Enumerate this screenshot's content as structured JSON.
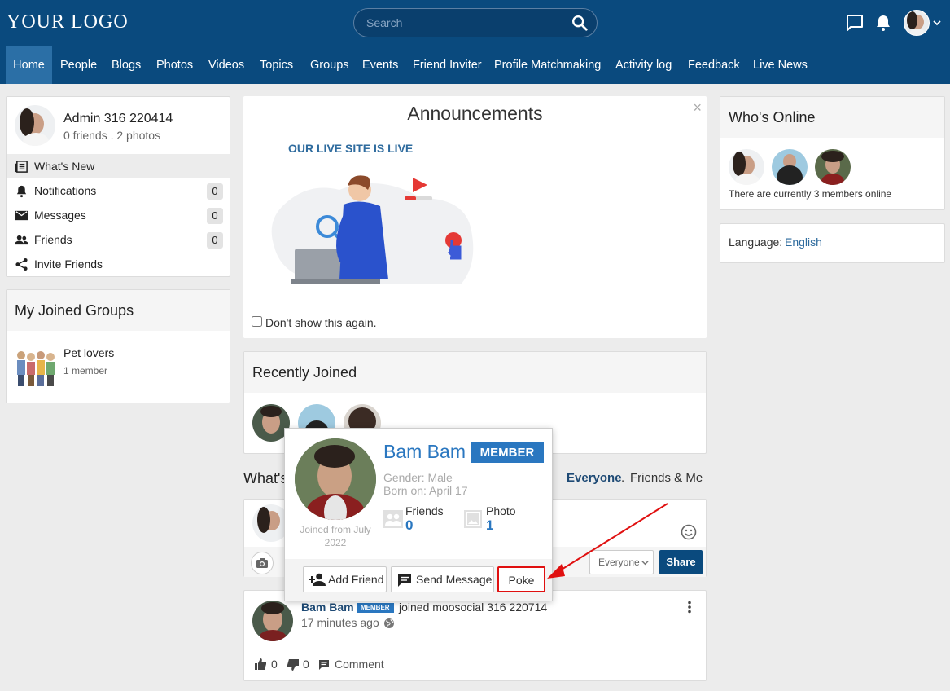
{
  "header": {
    "logo": "YOUR LOGO",
    "search_placeholder": "Search"
  },
  "nav": [
    "Home",
    "People",
    "Blogs",
    "Photos",
    "Videos",
    "Topics",
    "Groups",
    "Events",
    "Friend Inviter",
    "Profile Matchmaking",
    "Activity log",
    "Feedback",
    "Live News"
  ],
  "profile": {
    "name": "Admin 316 220414",
    "stats": "0 friends . 2 photos"
  },
  "menu": [
    {
      "label": "What's New",
      "icon": "newspaper-icon"
    },
    {
      "label": "Notifications",
      "icon": "bell-icon",
      "count": "0"
    },
    {
      "label": "Messages",
      "icon": "mail-icon",
      "count": "0"
    },
    {
      "label": "Friends",
      "icon": "friends-icon",
      "count": "0"
    },
    {
      "label": "Invite Friends",
      "icon": "share-icon"
    }
  ],
  "groups": {
    "title": "My Joined Groups",
    "items": [
      {
        "name": "Pet lovers",
        "members": "1 member"
      }
    ]
  },
  "announcement": {
    "title": "Announcements",
    "close": "×",
    "subtitle": "OUR LIVE SITE IS LIVE",
    "dont_show": "Don't show this again."
  },
  "recently_joined": {
    "title": "Recently Joined"
  },
  "whats_new": {
    "title_partial": "What's",
    "filter_everyone": "Everyone",
    "filter_sep": ".",
    "filter_friends": "Friends & Me",
    "privacy": "Everyone",
    "share": "Share"
  },
  "hovercard": {
    "name": "Bam Bam",
    "badge": "MEMBER",
    "gender": "Gender: Male",
    "born": "Born on: April 17",
    "joined": "Joined from July 2022",
    "friends_label": "Friends",
    "friends_count": "0",
    "photo_label": "Photo",
    "photo_count": "1",
    "add_friend": "Add Friend",
    "send_message": "Send Message",
    "poke": "Poke"
  },
  "activity": {
    "user": "Bam Bam",
    "badge": "MEMBER",
    "action": "joined moosocial 316 220714",
    "time": "17 minutes ago",
    "likes": "0",
    "dislikes": "0",
    "comment": "Comment"
  },
  "online": {
    "title": "Who's Online",
    "text": "There are currently 3 members online"
  },
  "language": {
    "label": "Language:",
    "value": "English"
  },
  "colors": {
    "header_bg": "#0a4a7e",
    "active_nav": "#2b6fa6",
    "member_badge": "#2a77c0",
    "highlight_red": "#e01010"
  }
}
